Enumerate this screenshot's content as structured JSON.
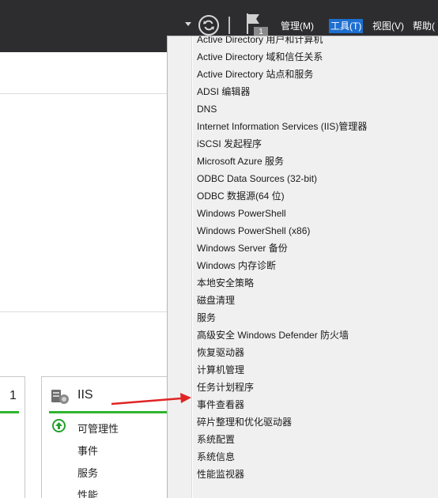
{
  "toolbar": {
    "flag_badge": "1",
    "menus": [
      {
        "label": "管理(M)",
        "active": false
      },
      {
        "label": "工具(T)",
        "active": true
      },
      {
        "label": "视图(V)",
        "active": false
      },
      {
        "label": "帮助(",
        "active": false
      }
    ]
  },
  "background": {
    "tile_number": "1",
    "tile_title": "IIS",
    "tile_rows": [
      "可管理性",
      "事件",
      "服务",
      "性能"
    ]
  },
  "tools_menu": {
    "items": [
      "Active Directory 用户和计算机",
      "Active Directory 域和信任关系",
      "Active Directory 站点和服务",
      "ADSI 编辑器",
      "DNS",
      "Internet Information Services (IIS)管理器",
      "iSCSI 发起程序",
      "Microsoft Azure 服务",
      "ODBC Data Sources (32-bit)",
      "ODBC 数据源(64 位)",
      "Windows PowerShell",
      "Windows PowerShell (x86)",
      "Windows Server 备份",
      "Windows 内存诊断",
      "本地安全策略",
      "磁盘清理",
      "服务",
      "高级安全 Windows Defender 防火墙",
      "恢复驱动器",
      "计算机管理",
      "任务计划程序",
      "事件查看器",
      "碎片整理和优化驱动器",
      "系统配置",
      "系统信息",
      "性能监视器"
    ]
  },
  "colors": {
    "toolbar_bg": "#2d2d30",
    "active_menu": "#1d6fd0",
    "status_green": "#2eb52e",
    "annotation_red": "#e02424"
  }
}
